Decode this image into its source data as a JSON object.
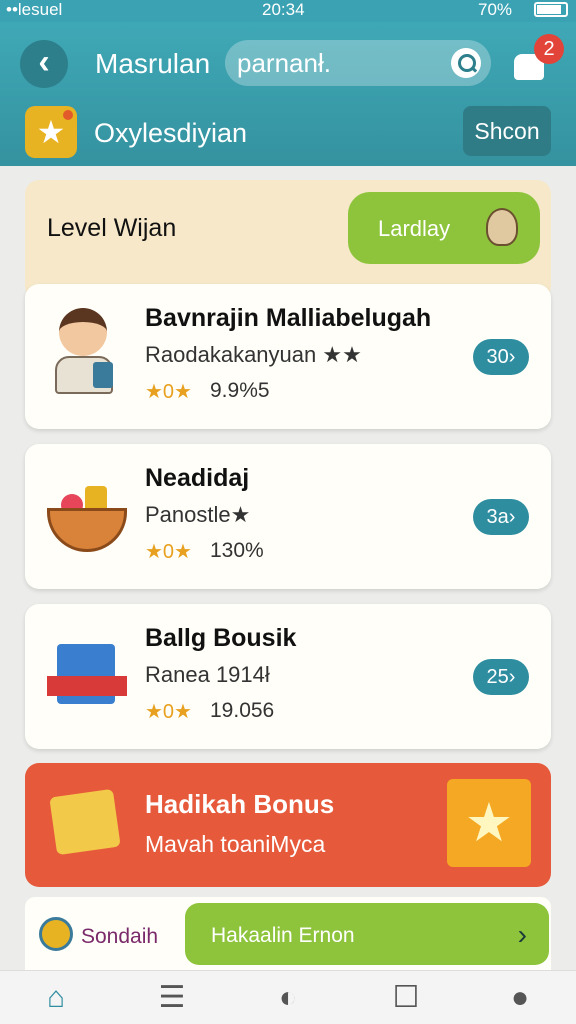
{
  "status": {
    "signal_text": "••lesuel",
    "time": "20:34",
    "battery": "70%"
  },
  "header": {
    "title": "Masrulan",
    "search_value": "parnanł.",
    "notif_count": "2"
  },
  "subheader": {
    "title": "Oxylesdiyian",
    "show_label": "Shcon"
  },
  "level": {
    "title": "Level Wijan",
    "button_label": "Lardlay"
  },
  "items": [
    {
      "name": "Bavnrajin Malliabelugah",
      "sub": "Raodakakanyuan ★★",
      "stars": "★0★",
      "score": "9.9%5",
      "pill": "30›"
    },
    {
      "name": "Neadidaj",
      "sub": "Panostle★",
      "stars": "★0★",
      "score": "130%",
      "pill": "3a›"
    },
    {
      "name": "Ballg Bousik",
      "sub": "Ranea 1914ł",
      "stars": "★0★",
      "score": "19.056",
      "pill": "25›"
    }
  ],
  "bonus": {
    "title": "Hadikah Bonus",
    "subtitle": "Mavah toaniMyca",
    "box_glyph": "★"
  },
  "bottom": {
    "label": "Sondaih",
    "button_label": "Hakaalin Ernon",
    "chevron": "›"
  },
  "tabs": {
    "home": "⌂",
    "menu": "☰",
    "discover": "◐",
    "chat": "☐",
    "user": "●"
  }
}
